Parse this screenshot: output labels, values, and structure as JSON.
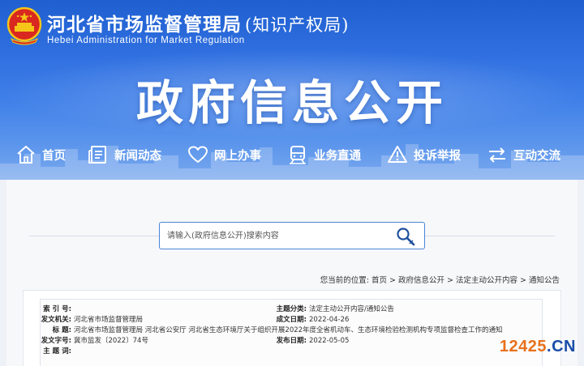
{
  "header": {
    "title_main": "河北省市场监督管理局",
    "title_sub": "(知识产权局)",
    "title_en": "Hebei Administration for Market Regulation",
    "banner_heading": "政府信息公开"
  },
  "nav": {
    "items": [
      {
        "label": "首页",
        "icon": "home-icon"
      },
      {
        "label": "新闻动态",
        "icon": "news-icon"
      },
      {
        "label": "网上办事",
        "icon": "heart-icon"
      },
      {
        "label": "业务直通",
        "icon": "train-icon"
      },
      {
        "label": "投诉举报",
        "icon": "warning-icon"
      },
      {
        "label": "互动交流",
        "icon": "exchange-icon"
      }
    ]
  },
  "search": {
    "placeholder": "请输入(政府信息公开)搜索内容"
  },
  "breadcrumb": {
    "prefix": "您当前的位置:",
    "items": [
      "首页",
      "政府信息公开",
      "法定主动公开内容",
      "通知公告"
    ],
    "separator": " > "
  },
  "info": {
    "index_label": "索 引 号:",
    "index_value": "",
    "category_label": "主题分类:",
    "category_value": "法定主动公开内容/通知公告",
    "issuer_label": "发文机关:",
    "issuer_value": "河北省市场监督管理局",
    "date_written_label": "成文日期:",
    "date_written_value": "2022-04-26",
    "title_label": "标    题:",
    "title_value": "河北省市场监督管理局 河北省公安厅 河北省生态环境厅关于组织开展2022年度全省机动车、生态环境检验检测机构专项监督检查工作的通知",
    "doc_no_label": "发文字号:",
    "doc_no_value": "冀市监发〔2022〕74号",
    "publish_label": "发布日期:",
    "publish_value": "2022-05-05",
    "keyword_label": "主 题 词:",
    "keyword_value": ""
  },
  "watermark": {
    "number": "12425",
    "dot": ".",
    "tld": "CN"
  },
  "colors": {
    "banner_top": "#1f5fcf",
    "banner_bottom": "#7aa9ee",
    "search_border": "#4a86d8",
    "watermark_orange": "#e8711b",
    "watermark_blue": "#1a4ea8"
  }
}
